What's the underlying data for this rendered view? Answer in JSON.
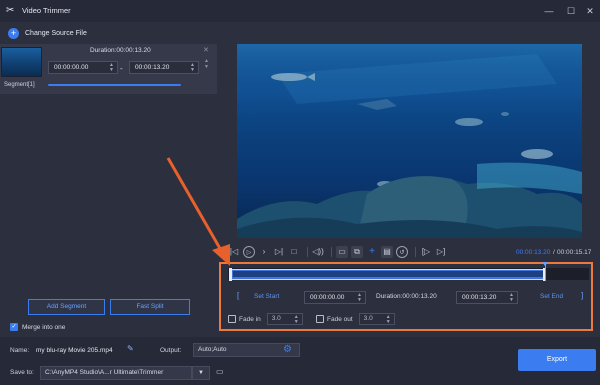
{
  "app": {
    "title": "Video Trimmer",
    "change_source_label": "Change Source File"
  },
  "window_controls": [
    "—",
    "☐",
    "✕"
  ],
  "segment": {
    "duration_label": "Duration:00:00:13.20",
    "start_value": "00:00:00.00",
    "end_value": "00:00:13.20",
    "separator": "-",
    "label": "Segment[1]"
  },
  "left_buttons": {
    "add_segment": "Add Segment",
    "fast_split": "Fast Split",
    "merge_label": "Merge into one"
  },
  "player": {
    "time_current": "00:00:13.20",
    "time_total": "00:00:15.17",
    "time_separator": "/"
  },
  "trim": {
    "set_start": "Set Start",
    "start_value": "00:00:00.00",
    "duration": "Duration:00:00:13.20",
    "end_value": "00:00:13.20",
    "set_end": "Set End",
    "fade_in_label": "Fade in",
    "fade_in_value": "3.0",
    "fade_out_label": "Fade out",
    "fade_out_value": "3.0",
    "selection_fraction": 0.87
  },
  "bottom": {
    "name_label": "Name:",
    "name_value": "my blu-ray Movie 205.mp4",
    "output_label": "Output:",
    "output_value": "Auto;Auto",
    "save_label": "Save to:",
    "save_value": "C:\\AnyMP4 Studio\\A...r Ultimate\\Trimmer",
    "export_label": "Export"
  },
  "colors": {
    "accent": "#3b7df0",
    "highlight": "#ec7a3d"
  }
}
